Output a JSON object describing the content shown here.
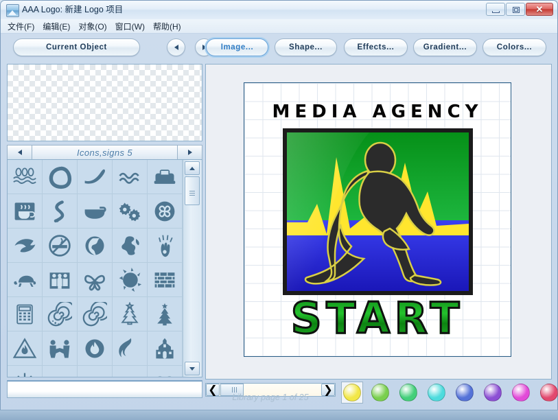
{
  "window": {
    "title": "AAA Logo: 新建 Logo 项目",
    "icon": "app-logo-icon",
    "controls": {
      "minimize": "–",
      "maximize": "□",
      "close": "✕"
    }
  },
  "menu": {
    "items": [
      {
        "label": "文件(F)",
        "name": "file"
      },
      {
        "label": "编辑(E)",
        "name": "edit"
      },
      {
        "label": "对象(O)",
        "name": "object"
      },
      {
        "label": "窗口(W)",
        "name": "window"
      },
      {
        "label": "帮助(H)",
        "name": "help"
      }
    ]
  },
  "toolbar": {
    "current_object": "Current Object",
    "prev_arrow": "prev-object-arrow",
    "next_arrow": "next-object-arrow",
    "buttons": [
      {
        "label": "Image...",
        "selected": true
      },
      {
        "label": "Shape...",
        "selected": false
      },
      {
        "label": "Effects...",
        "selected": false
      },
      {
        "label": "Gradient...",
        "selected": false
      },
      {
        "label": "Colors...",
        "selected": false
      }
    ]
  },
  "left_panel": {
    "preview_label": "transparent-preview",
    "library": {
      "name": "Icons,signs 5",
      "prev": "◄",
      "next": "►"
    },
    "scrollbar": {
      "up": "▲",
      "down": "▼"
    },
    "icons": [
      "waves-triple-icon",
      "loop-ribbon-icon",
      "swoosh-check-icon",
      "wavy-lines-icon",
      "telephone-icon",
      "hot-coffee-cup-icon",
      "snake-curve-icon",
      "bowl-icon",
      "gears-icon",
      "pinwheel-swirl-icon",
      "wave-curl-icon",
      "no-smoking-icon",
      "globe-icon",
      "globe-americas-icon",
      "handprint-icon",
      "turtle-icon",
      "family-group-icon",
      "butterfly-outline-icon",
      "sun-splash-icon",
      "brick-wall-icon",
      "calculator-icon",
      "spiral-dotted-icon",
      "spiral-icon",
      "christmas-tree-outline-icon",
      "pine-tree-icon",
      "fire-warning-triangle-icon",
      "handshake-icon",
      "fire-circle-icon",
      "flame-icon",
      "church-icon",
      "sun-rays-icon",
      "house-roof-icon",
      "blank-icon",
      "blank-icon",
      "palm-tree-icon"
    ]
  },
  "canvas": {
    "logo_title": "MEDIA AGENCY",
    "logo_word": "START",
    "artwork": "sprinter-silhouette-logo",
    "artwork_colors": {
      "top": "#0fa82a",
      "bottom": "#2a30d8",
      "accent": "#ffe62e",
      "figure": "#2b2b2b",
      "frame": "#1b1b1b"
    }
  },
  "bottom_bar": {
    "library_page": "Library page 1 of 25",
    "scroll_prev": "❮",
    "scroll_next": "❯",
    "swatches": [
      {
        "name": "yellow",
        "color": "#f2e747",
        "selected": true
      },
      {
        "name": "light-green",
        "color": "#79cf4e",
        "selected": false
      },
      {
        "name": "green",
        "color": "#43cf7a",
        "selected": false
      },
      {
        "name": "cyan",
        "color": "#4ddbdd",
        "selected": false
      },
      {
        "name": "blue",
        "color": "#5472d8",
        "selected": false
      },
      {
        "name": "purple",
        "color": "#8c4fd4",
        "selected": false
      },
      {
        "name": "magenta",
        "color": "#e24ad8",
        "selected": false
      },
      {
        "name": "pink-red",
        "color": "#e2486e",
        "selected": false
      },
      {
        "name": "orange",
        "color": "#ee8c3a",
        "selected": false
      }
    ]
  }
}
